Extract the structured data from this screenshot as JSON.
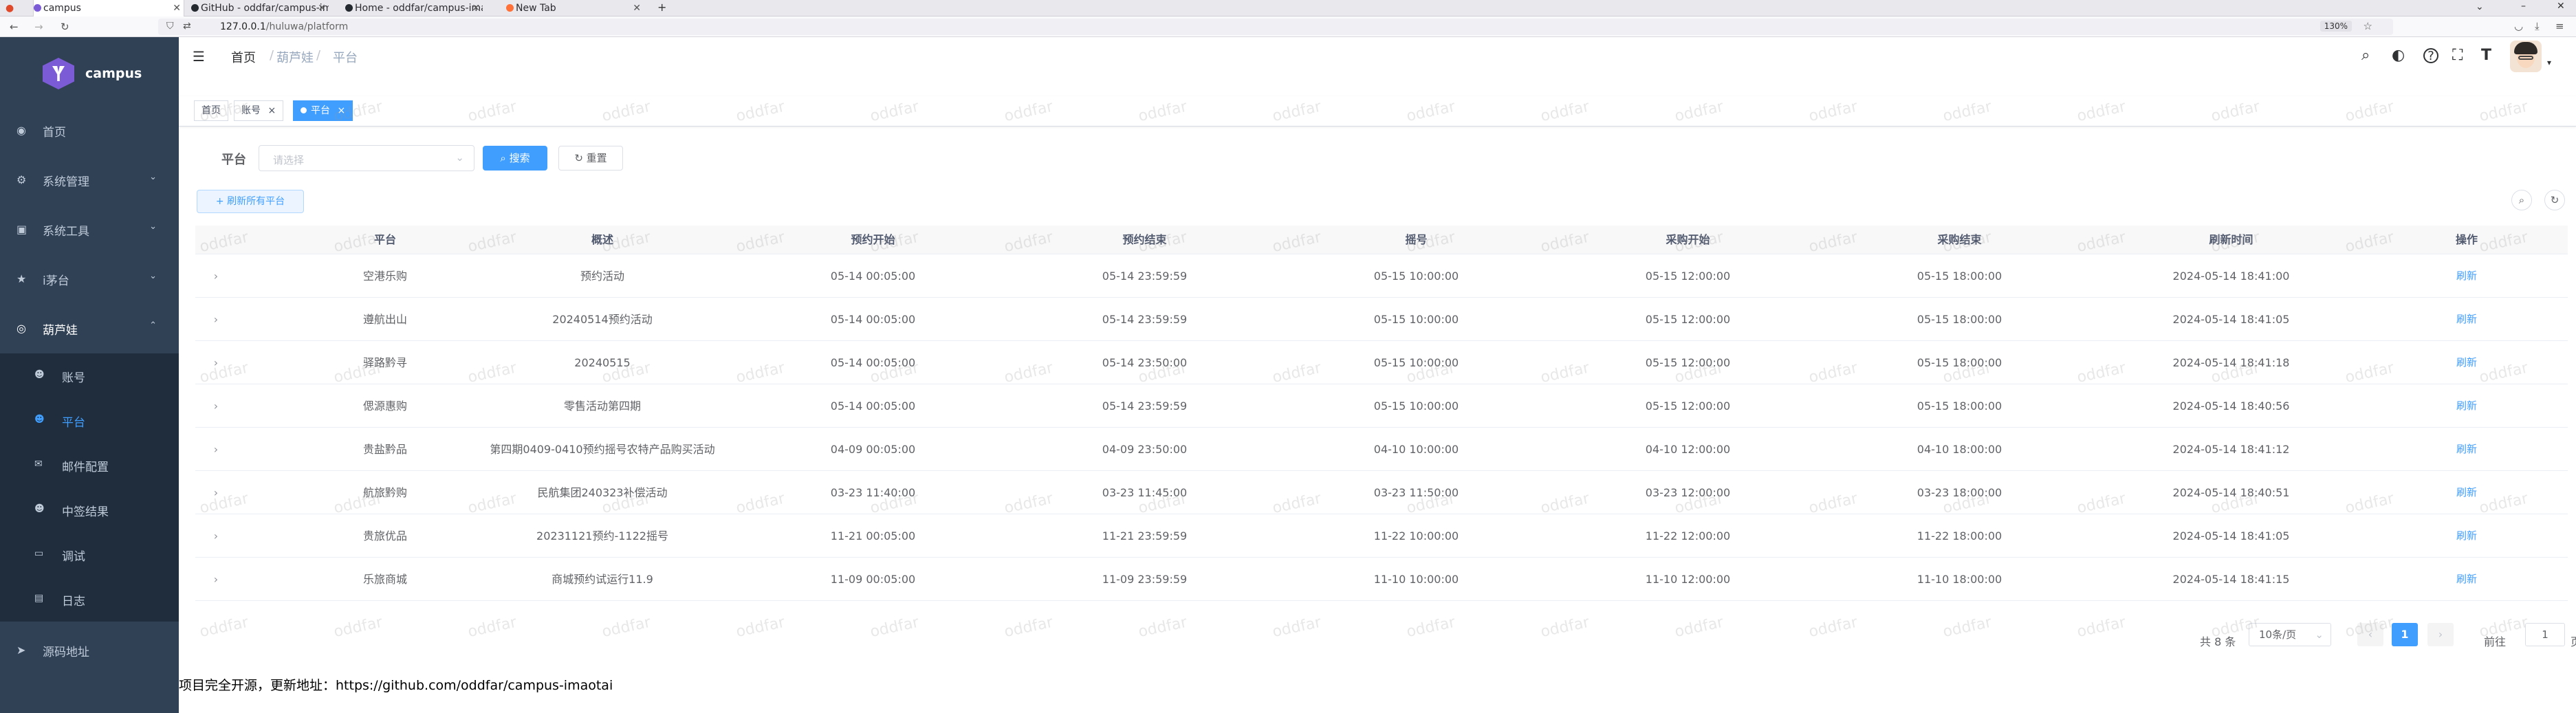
{
  "browser": {
    "tabs": [
      {
        "title": "campus",
        "icon_color": "#7b5cd6",
        "active": true
      },
      {
        "title": "GitHub - oddfar/campus-imaotai",
        "icon_color": "#24292f",
        "active": false
      },
      {
        "title": "Home - oddfar/campus-imaotai",
        "icon_color": "#24292f",
        "active": false
      },
      {
        "title": "New Tab",
        "icon_color": "#ff7139",
        "active": false
      }
    ],
    "new_tab": "+",
    "url_host": "127.0.0.1",
    "url_path": "/huluwa/platform",
    "zoom": "130%"
  },
  "sidebar": {
    "app_name": "campus",
    "menu": [
      {
        "label": "首页",
        "icon": "dashboard-icon",
        "glyph": "◉"
      },
      {
        "label": "系统管理",
        "icon": "gear-icon",
        "glyph": "⚙",
        "arrow": "⌄"
      },
      {
        "label": "系统工具",
        "icon": "toolbox-icon",
        "glyph": "▣",
        "arrow": "⌄"
      },
      {
        "label": "i茅台",
        "icon": "star-icon",
        "glyph": "★",
        "arrow": "⌄"
      },
      {
        "label": "葫芦娃",
        "icon": "eye-icon",
        "glyph": "◎",
        "arrow": "⌃"
      }
    ],
    "submenu": [
      {
        "label": "账号",
        "icon": "user-icon",
        "glyph": "☻"
      },
      {
        "label": "平台",
        "icon": "user-icon",
        "glyph": "☻"
      },
      {
        "label": "邮件配置",
        "icon": "mail-icon",
        "glyph": "✉"
      },
      {
        "label": "中签结果",
        "icon": "user-icon",
        "glyph": "☻"
      },
      {
        "label": "调试",
        "icon": "monitor-icon",
        "glyph": "▭"
      },
      {
        "label": "日志",
        "icon": "log-icon",
        "glyph": "▤"
      }
    ],
    "source": {
      "label": "源码地址",
      "icon": "send-icon",
      "glyph": "➤"
    }
  },
  "header": {
    "breadcrumb": [
      "首页",
      "葫芦娃",
      "平台"
    ],
    "separator": "/",
    "icons": [
      {
        "name": "search-icon",
        "glyph": "⌕"
      },
      {
        "name": "github-icon",
        "glyph": "◐"
      },
      {
        "name": "help-icon",
        "glyph": "?"
      },
      {
        "name": "fullscreen-icon",
        "glyph": "⛶"
      },
      {
        "name": "font-size-icon",
        "glyph": "T"
      }
    ]
  },
  "tags": [
    {
      "label": "首页",
      "active": false,
      "close": ""
    },
    {
      "label": "账号",
      "active": false,
      "close": "×"
    },
    {
      "label": "平台",
      "active": true,
      "close": "×"
    }
  ],
  "search": {
    "label": "平台",
    "placeholder": "请选择",
    "search_button": "搜索",
    "reset_button": "重置"
  },
  "toolbar": {
    "refresh_all": "刷新所有平台"
  },
  "table": {
    "columns": [
      "平台",
      "概述",
      "预约开始",
      "预约结束",
      "摇号",
      "采购开始",
      "采购结束",
      "刷新时间",
      "操作"
    ],
    "rows": [
      [
        "空港乐购",
        "预约活动",
        "05-14 00:05:00",
        "05-14 23:59:59",
        "05-15 10:00:00",
        "05-15 12:00:00",
        "05-15 18:00:00",
        "2024-05-14 18:41:00",
        "刷新"
      ],
      [
        "遵航出山",
        "20240514预约活动",
        "05-14 00:05:00",
        "05-14 23:59:59",
        "05-15 10:00:00",
        "05-15 12:00:00",
        "05-15 18:00:00",
        "2024-05-14 18:41:05",
        "刷新"
      ],
      [
        "驿路黔寻",
        "20240515",
        "05-14 00:05:00",
        "05-14 23:50:00",
        "05-15 10:00:00",
        "05-15 12:00:00",
        "05-15 18:00:00",
        "2024-05-14 18:41:18",
        "刷新"
      ],
      [
        "偲源惠购",
        "零售活动第四期",
        "05-14 00:05:00",
        "05-14 23:59:59",
        "05-15 10:00:00",
        "05-15 12:00:00",
        "05-15 18:00:00",
        "2024-05-14 18:40:56",
        "刷新"
      ],
      [
        "贵盐黔品",
        "第四期0409-0410预约摇号农特产品购买活动",
        "04-09 00:05:00",
        "04-09 23:50:00",
        "04-10 10:00:00",
        "04-10 12:00:00",
        "04-10 18:00:00",
        "2024-05-14 18:41:12",
        "刷新"
      ],
      [
        "航旅黔购",
        "民航集团240323补偿活动",
        "03-23 11:40:00",
        "03-23 11:45:00",
        "03-23 11:50:00",
        "03-23 12:00:00",
        "03-23 18:00:00",
        "2024-05-14 18:40:51",
        "刷新"
      ],
      [
        "贵旅优品",
        "20231121预约-1122摇号",
        "11-21 00:05:00",
        "11-21 23:59:59",
        "11-22 10:00:00",
        "11-22 12:00:00",
        "11-22 18:00:00",
        "2024-05-14 18:41:05",
        "刷新"
      ],
      [
        "乐旅商城",
        "商城预约试运行11.9",
        "11-09 00:05:00",
        "11-09 23:59:59",
        "11-10 10:00:00",
        "11-10 12:00:00",
        "11-10 18:00:00",
        "2024-05-14 18:41:15",
        "刷新"
      ]
    ]
  },
  "pagination": {
    "total": "共 8 条",
    "page_size": "10条/页",
    "prev": "‹",
    "current": "1",
    "next": "›",
    "goto_label": "前往",
    "goto_value": "1",
    "goto_suffix": "页"
  },
  "footer": "项目完全开源，更新地址：https://github.com/oddfar/campus-imaotai",
  "watermark": "oddfar",
  "colors": {
    "sidebar_bg": "#304156",
    "submenu_bg": "#1f2d3d",
    "accent": "#409eff"
  }
}
